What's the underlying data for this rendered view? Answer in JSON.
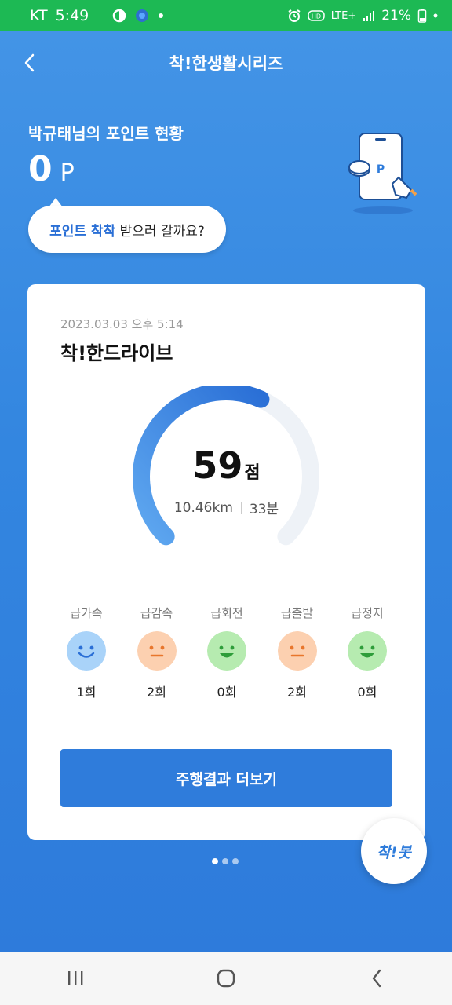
{
  "status_bar": {
    "carrier": "KT",
    "time": "5:49",
    "network": "LTE+",
    "battery": "21%"
  },
  "header": {
    "title": "착!한생활시리즈",
    "back_icon": "chevron-left-icon"
  },
  "points": {
    "label": "박규태님의 포인트 현황",
    "value": "0",
    "unit": "P"
  },
  "bubble": {
    "highlight": "포인트 착착",
    "rest": " 받으러 갈까요?"
  },
  "card": {
    "date": "2023.03.03 오후 5:14",
    "title": "착!한드라이브",
    "score": "59",
    "score_unit": "점",
    "score_fraction": 0.59,
    "distance": "10.46km",
    "duration": "33분",
    "events": [
      {
        "label": "급가속",
        "count": "1회",
        "face": "smile",
        "color": "#a9d3f9"
      },
      {
        "label": "급감속",
        "count": "2회",
        "face": "neutral",
        "color": "#fcd0b0"
      },
      {
        "label": "급회전",
        "count": "0회",
        "face": "grin",
        "color": "#b6ebb0"
      },
      {
        "label": "급출발",
        "count": "2회",
        "face": "neutral",
        "color": "#fcd0b0"
      },
      {
        "label": "급정지",
        "count": "0회",
        "face": "grin",
        "color": "#b6ebb0"
      }
    ],
    "more_button": "주행결과 더보기"
  },
  "pager": {
    "count": 3,
    "active": 1
  },
  "fab": {
    "label": "착!봇"
  },
  "nav": [
    "recent-apps-icon",
    "home-icon",
    "back-icon"
  ],
  "colors": {
    "primary": "#2f7cdb",
    "status_green": "#1db954"
  }
}
